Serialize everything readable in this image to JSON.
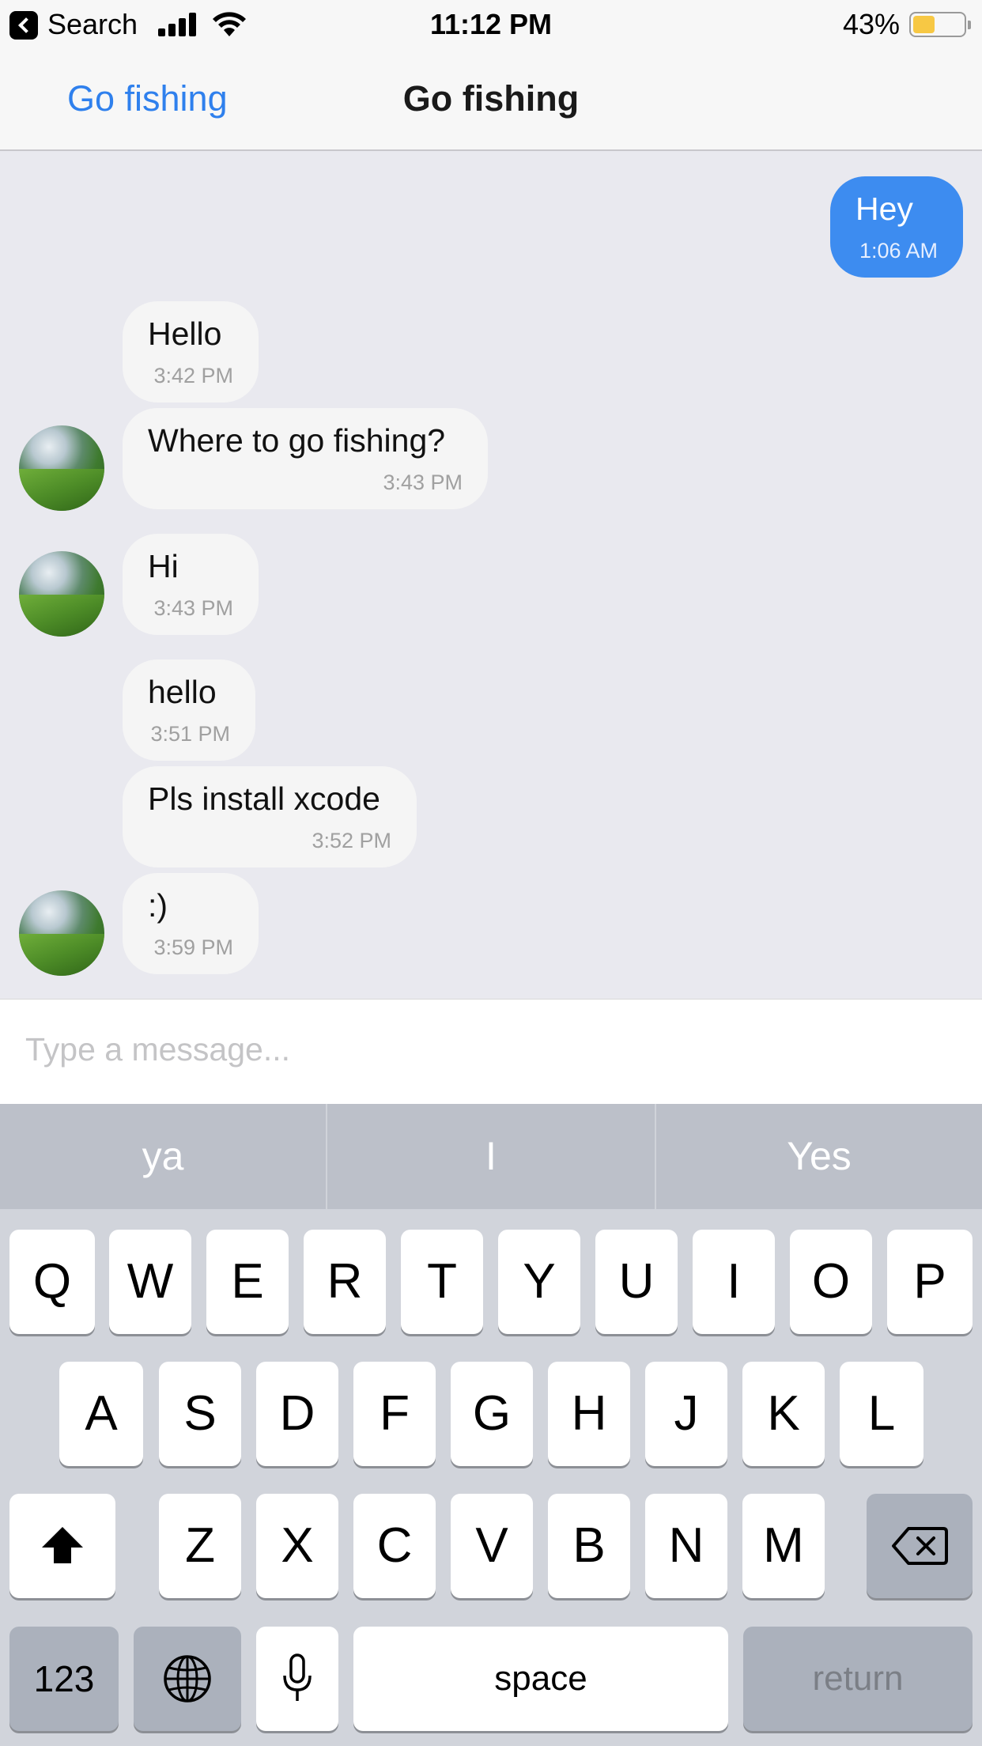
{
  "status_bar": {
    "back_app": "Search",
    "time": "11:12 PM",
    "battery_percent": "43%",
    "battery_level": 0.43,
    "battery_color": "#f7c844"
  },
  "nav": {
    "back_label": "Go fishing",
    "title": "Go fishing"
  },
  "messages": [
    {
      "direction": "outgoing",
      "text": "Hey",
      "time": "1:06 AM",
      "avatar": false
    },
    {
      "direction": "incoming",
      "text": "Hello",
      "time": "3:42 PM",
      "avatar": false
    },
    {
      "direction": "incoming",
      "text": "Where to go fishing?",
      "time": "3:43 PM",
      "avatar": true
    },
    {
      "direction": "incoming",
      "text": "Hi",
      "time": "3:43 PM",
      "avatar": true
    },
    {
      "direction": "incoming",
      "text": "hello",
      "time": "3:51 PM",
      "avatar": false
    },
    {
      "direction": "incoming",
      "text": "Pls install xcode",
      "time": "3:52 PM",
      "avatar": false
    },
    {
      "direction": "incoming",
      "text": ":)",
      "time": "3:59 PM",
      "avatar": true
    }
  ],
  "composer": {
    "placeholder": "Type a message..."
  },
  "keyboard": {
    "suggestions": [
      "ya",
      "I",
      "Yes"
    ],
    "row1": [
      "Q",
      "W",
      "E",
      "R",
      "T",
      "Y",
      "U",
      "I",
      "O",
      "P"
    ],
    "row2": [
      "A",
      "S",
      "D",
      "F",
      "G",
      "H",
      "J",
      "K",
      "L"
    ],
    "row3": [
      "Z",
      "X",
      "C",
      "V",
      "B",
      "N",
      "M"
    ],
    "numbers_key": "123",
    "space_key": "space",
    "return_key": "return",
    "shift_icon": "shift-icon",
    "delete_icon": "delete-icon",
    "globe_icon": "globe-icon",
    "mic_icon": "microphone-icon"
  },
  "colors": {
    "accent": "#2f80ed",
    "outgoing_bubble": "#3d8cf0",
    "incoming_bubble": "#f5f5f5",
    "chat_background": "#e9e9ef"
  }
}
